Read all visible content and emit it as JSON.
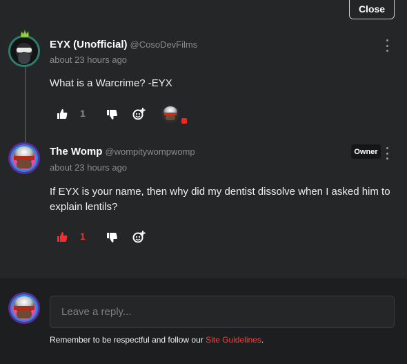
{
  "close_label": "Close",
  "comments": [
    {
      "author": "EYX (Unofficial)",
      "handle": "@CosoDevFilms",
      "time": "about 23 hours ago",
      "text": "What is a Warcrime? -EYX",
      "likes": "1",
      "liked": false
    },
    {
      "author": "The Womp",
      "handle": "@wompitywompwomp",
      "time": "about 23 hours ago",
      "badge": "Owner",
      "text": "If EYX is your name, then why did my dentist dissolve when I asked him to explain lentils?",
      "likes": "1",
      "liked": true
    }
  ],
  "reply": {
    "placeholder": "Leave a reply...",
    "guidelines_prefix": "Remember to be respectful and follow our ",
    "guidelines_link": "Site Guidelines",
    "guidelines_suffix": "."
  },
  "colors": {
    "background": "#252627",
    "panel": "#1d1e1f",
    "accent_red": "#ff3b3b",
    "muted_text": "#8a8b8c"
  },
  "icons": [
    "thumbs-up-icon",
    "thumbs-down-icon",
    "add-reaction-icon",
    "more-options-icon"
  ]
}
